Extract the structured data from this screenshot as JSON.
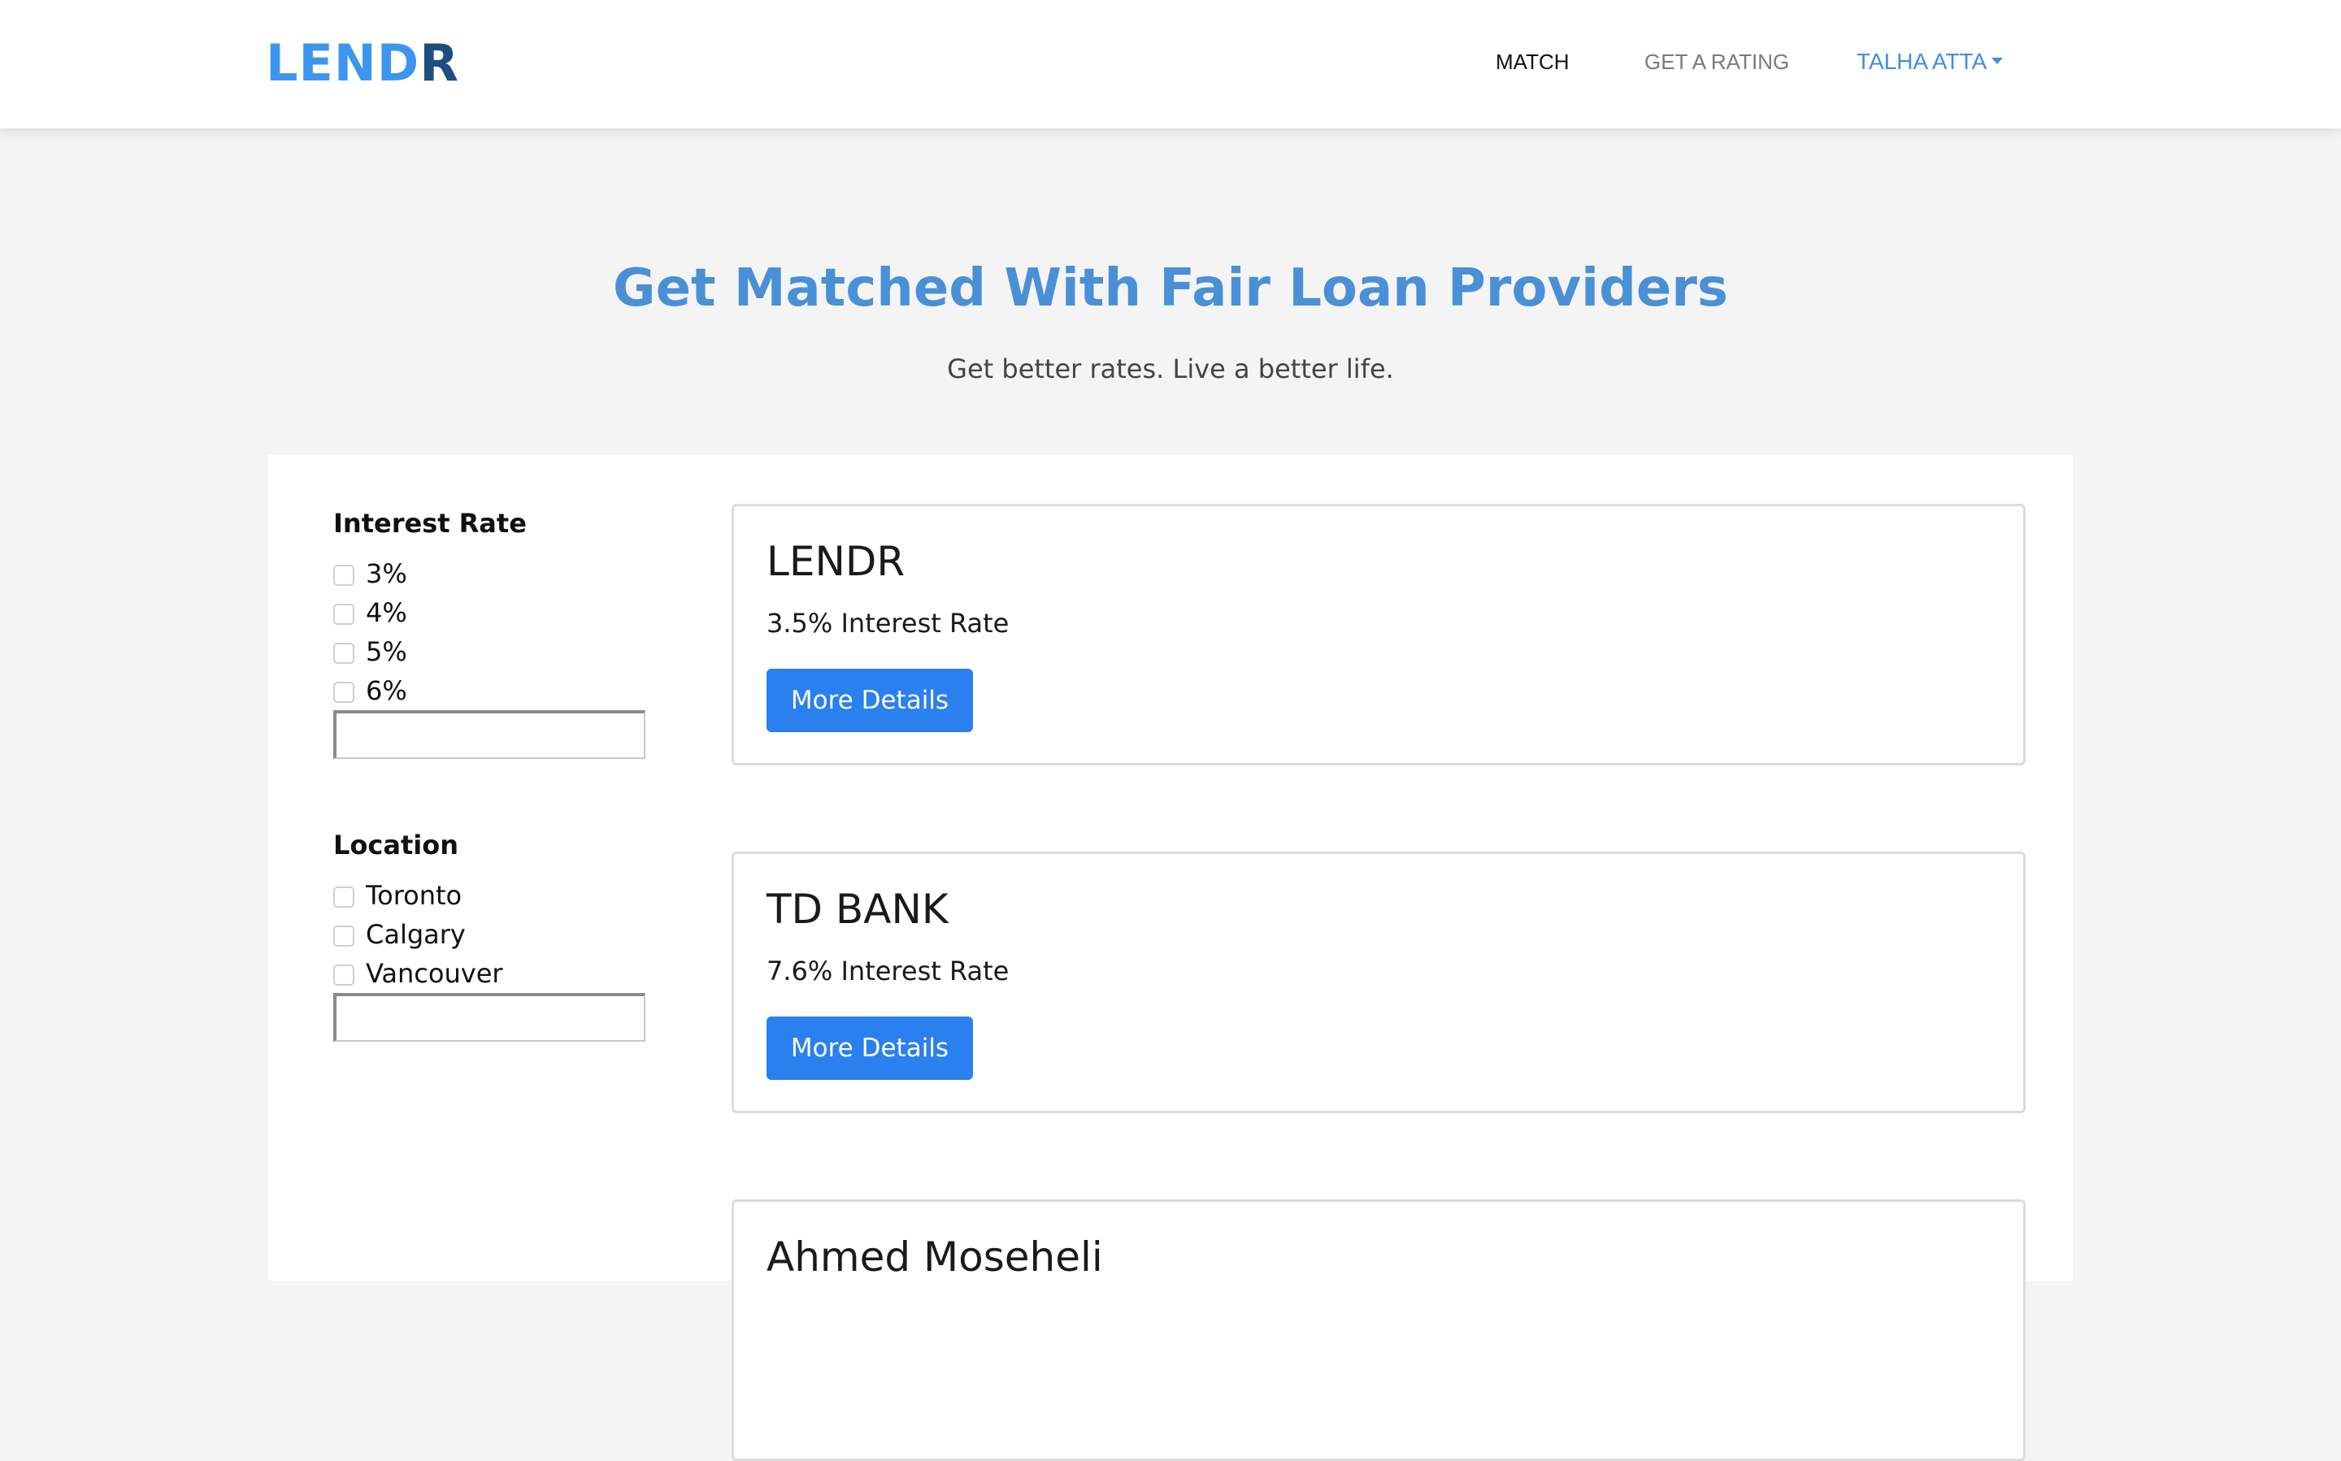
{
  "navbar": {
    "logo_part1": "LEND",
    "logo_part2": "R",
    "links": {
      "match": "MATCH",
      "get_rating": "GET A RATING",
      "user": "TALHA ATTA"
    }
  },
  "hero": {
    "title": "Get Matched With Fair Loan Providers",
    "subtitle": "Get better rates. Live a better life."
  },
  "filters": {
    "interest": {
      "title": "Interest Rate",
      "options": [
        "3%",
        "4%",
        "5%",
        "6%"
      ],
      "input_value": ""
    },
    "location": {
      "title": "Location",
      "options": [
        "Toronto",
        "Calgary",
        "Vancouver"
      ],
      "input_value": ""
    }
  },
  "lenders": [
    {
      "name": "LENDR",
      "rate": "3.5% Interest Rate",
      "button": "More Details"
    },
    {
      "name": "TD BANK",
      "rate": "7.6% Interest Rate",
      "button": "More Details"
    },
    {
      "name": "Ahmed Moseheli",
      "rate": "",
      "button": ""
    }
  ],
  "colors": {
    "brand_light": "#3d95ef",
    "brand_dark": "#1c4e80",
    "accent": "#2a80ef",
    "hero_title": "#4a90d6",
    "page_bg": "#f4f4f4"
  }
}
